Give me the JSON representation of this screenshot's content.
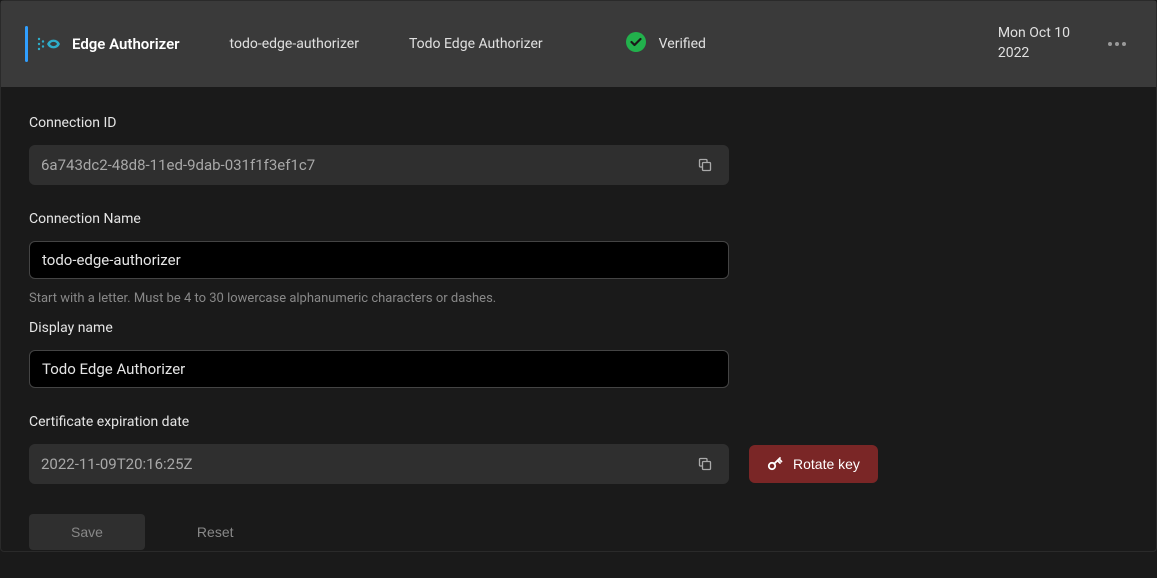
{
  "header": {
    "title": "Edge Authorizer",
    "name": "todo-edge-authorizer",
    "displayName": "Todo Edge Authorizer",
    "status": "Verified",
    "dateLine1": "Mon Oct 10",
    "dateLine2": "2022"
  },
  "fields": {
    "connectionId": {
      "label": "Connection ID",
      "value": "6a743dc2-48d8-11ed-9dab-031f1f3ef1c7"
    },
    "connectionName": {
      "label": "Connection Name",
      "value": "todo-edge-authorizer",
      "help": "Start with a letter. Must be 4 to 30 lowercase alphanumeric characters or dashes."
    },
    "displayName": {
      "label": "Display name",
      "value": "Todo Edge Authorizer"
    },
    "certExpiration": {
      "label": "Certificate expiration date",
      "value": "2022-11-09T20:16:25Z"
    }
  },
  "buttons": {
    "rotateKey": "Rotate key",
    "save": "Save",
    "reset": "Reset"
  }
}
